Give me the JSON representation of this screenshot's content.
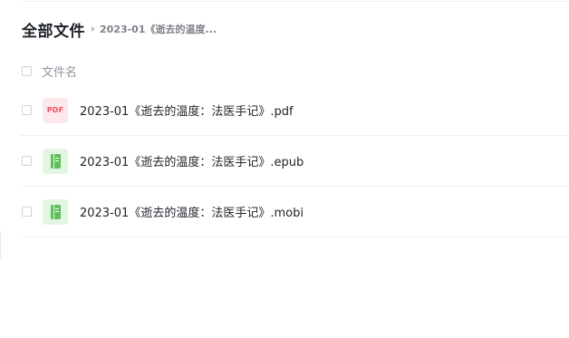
{
  "breadcrumb": {
    "root": "全部文件",
    "current": "2023-01《逝去的温度..."
  },
  "list_header": {
    "name_column": "文件名"
  },
  "files": [
    {
      "name": "2023-01《逝去的温度：法医手记》.pdf",
      "type": "pdf",
      "icon": "pdf-file-icon",
      "icon_label": "PDF"
    },
    {
      "name": "2023-01《逝去的温度：法医手记》.epub",
      "type": "epub",
      "icon": "ebook-file-icon"
    },
    {
      "name": "2023-01《逝去的温度：法医手记》.mobi",
      "type": "mobi",
      "icon": "ebook-file-icon"
    }
  ],
  "colors": {
    "pdf_accent": "#f05361",
    "ebook_accent": "#5fbf5b",
    "text_primary": "#1f2329",
    "text_secondary": "#8f959e"
  }
}
